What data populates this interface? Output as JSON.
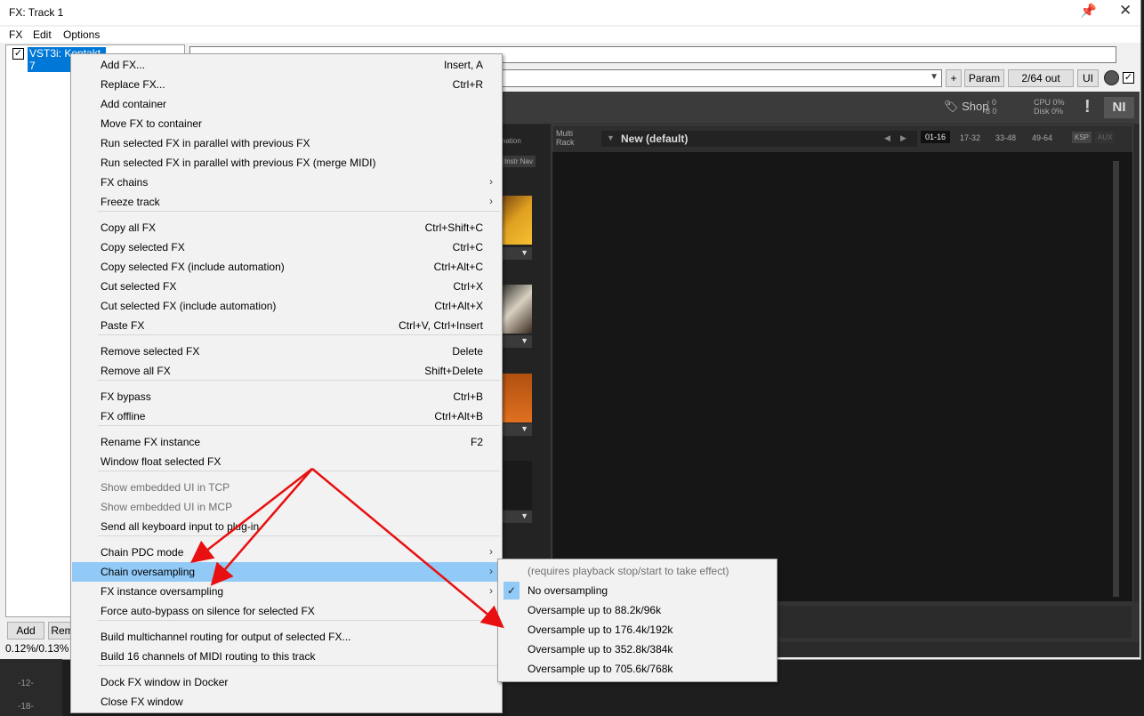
{
  "window": {
    "title": "FX: Track 1",
    "menubar": [
      "FX",
      "Edit",
      "Options"
    ]
  },
  "fx_list": {
    "item_checked": "✓",
    "item_name": "VST3i: Kontakt 7",
    "add_label": "Add",
    "remove_label": "Rem",
    "cpu": "0.12%/0.13% C"
  },
  "header": {
    "plus_label": "+",
    "param_label": "Param",
    "io_label": "2/64 out",
    "ui_label": "UI",
    "ui_checked": "✓"
  },
  "plugin": {
    "shop": "Shop",
    "midi_in": "♪ 0",
    "midi_out": "8 0",
    "cpu_text": "CPU 0%",
    "disk_text": "Disk 0%",
    "warn": "!",
    "logo": "NI",
    "left_pane_label": "nation",
    "instr_nav": "Instr Nav",
    "rack_label_1": "Multi",
    "rack_label_2": "Rack",
    "rack_preset": "New (default)",
    "rack_tabs": [
      "01-16",
      "17-32",
      "33-48",
      "49-64"
    ],
    "ksp": "KSP",
    "aux": "AUX"
  },
  "background": {
    "db_1": "-12-",
    "db_2": "-18-"
  },
  "context_menu": {
    "items": [
      {
        "label": "Add FX...",
        "shortcut": "Insert, A",
        "submenu": false,
        "disabled": false
      },
      {
        "label": "Replace FX...",
        "shortcut": "Ctrl+R",
        "submenu": false,
        "disabled": false
      },
      {
        "label": "Add container",
        "shortcut": "",
        "submenu": false,
        "disabled": false
      },
      {
        "label": "Move FX to container",
        "shortcut": "",
        "submenu": false,
        "disabled": false
      },
      {
        "label": "Run selected FX in parallel with previous FX",
        "shortcut": "",
        "submenu": false,
        "disabled": false
      },
      {
        "label": "Run selected FX in parallel with previous FX (merge MIDI)",
        "shortcut": "",
        "submenu": false,
        "disabled": false
      },
      {
        "label": "FX chains",
        "shortcut": "",
        "submenu": true,
        "disabled": false
      },
      {
        "label": "Freeze track",
        "shortcut": "",
        "submenu": true,
        "disabled": false
      },
      {
        "label": "Copy all FX",
        "shortcut": "Ctrl+Shift+C",
        "submenu": false,
        "disabled": false
      },
      {
        "label": "Copy selected FX",
        "shortcut": "Ctrl+C",
        "submenu": false,
        "disabled": false
      },
      {
        "label": "Copy selected FX (include automation)",
        "shortcut": "Ctrl+Alt+C",
        "submenu": false,
        "disabled": false
      },
      {
        "label": "Cut selected FX",
        "shortcut": "Ctrl+X",
        "submenu": false,
        "disabled": false
      },
      {
        "label": "Cut selected FX (include automation)",
        "shortcut": "Ctrl+Alt+X",
        "submenu": false,
        "disabled": false
      },
      {
        "label": "Paste FX",
        "shortcut": "Ctrl+V, Ctrl+Insert",
        "submenu": false,
        "disabled": false
      },
      {
        "label": "Remove selected FX",
        "shortcut": "Delete",
        "submenu": false,
        "disabled": false
      },
      {
        "label": "Remove all FX",
        "shortcut": "Shift+Delete",
        "submenu": false,
        "disabled": false
      },
      {
        "label": "FX bypass",
        "shortcut": "Ctrl+B",
        "submenu": false,
        "disabled": false
      },
      {
        "label": "FX offline",
        "shortcut": "Ctrl+Alt+B",
        "submenu": false,
        "disabled": false
      },
      {
        "label": "Rename FX instance",
        "shortcut": "F2",
        "submenu": false,
        "disabled": false
      },
      {
        "label": "Window float selected FX",
        "shortcut": "",
        "submenu": false,
        "disabled": false
      },
      {
        "label": "Show embedded UI in TCP",
        "shortcut": "",
        "submenu": false,
        "disabled": true
      },
      {
        "label": "Show embedded UI in MCP",
        "shortcut": "",
        "submenu": false,
        "disabled": true
      },
      {
        "label": "Send all keyboard input to plug-in",
        "shortcut": "",
        "submenu": false,
        "disabled": false
      },
      {
        "label": "Chain PDC mode",
        "shortcut": "",
        "submenu": true,
        "disabled": false
      },
      {
        "label": "Chain oversampling",
        "shortcut": "",
        "submenu": true,
        "disabled": false,
        "highlighted": true
      },
      {
        "label": "FX instance oversampling",
        "shortcut": "",
        "submenu": true,
        "disabled": false
      },
      {
        "label": "Force auto-bypass on silence for selected FX",
        "shortcut": "",
        "submenu": false,
        "disabled": false
      },
      {
        "label": "Build multichannel routing for output of selected FX...",
        "shortcut": "",
        "submenu": false,
        "disabled": false
      },
      {
        "label": "Build 16 channels of MIDI routing to this track",
        "shortcut": "",
        "submenu": false,
        "disabled": false
      },
      {
        "label": "Dock FX window in Docker",
        "shortcut": "",
        "submenu": false,
        "disabled": false
      },
      {
        "label": "Close FX window",
        "shortcut": "",
        "submenu": false,
        "disabled": false
      }
    ],
    "submenu_arrow": "›"
  },
  "submenu": {
    "items": [
      {
        "label": "(requires playback stop/start to take effect)",
        "disabled": true,
        "checked": false
      },
      {
        "label": "No oversampling",
        "disabled": false,
        "checked": true
      },
      {
        "label": "Oversample up to 88.2k/96k",
        "disabled": false,
        "checked": false
      },
      {
        "label": "Oversample up to 176.4k/192k",
        "disabled": false,
        "checked": false
      },
      {
        "label": "Oversample up to 352.8k/384k",
        "disabled": false,
        "checked": false
      },
      {
        "label": "Oversample up to 705.6k/768k",
        "disabled": false,
        "checked": false
      }
    ],
    "check_mark": "✓"
  },
  "colors": {
    "highlight": "#91c9f7",
    "annotation_arrow": "#e81010",
    "selection": "#0078d7"
  }
}
